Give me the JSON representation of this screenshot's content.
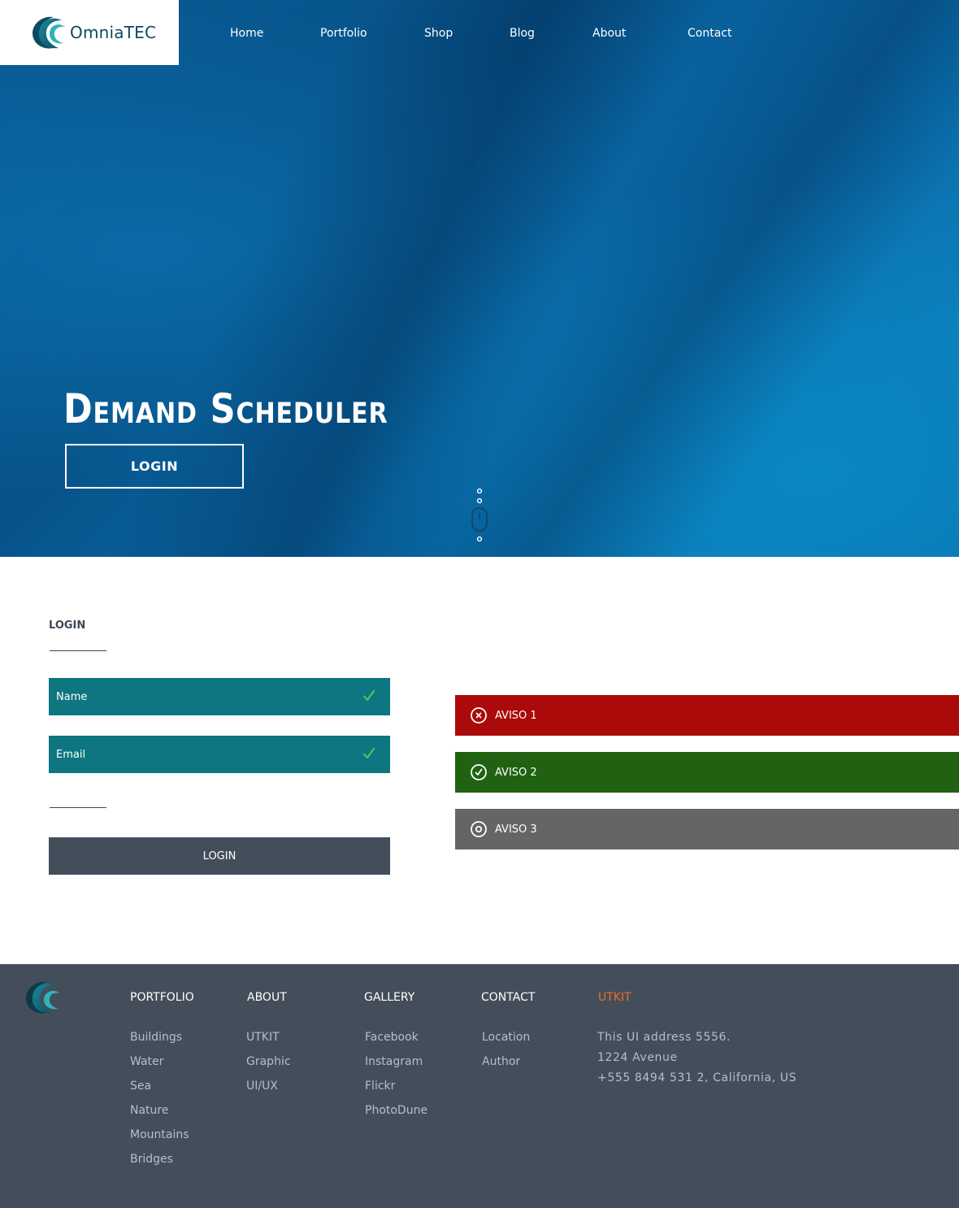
{
  "header": {
    "logo_text": "OmniaTEC",
    "nav": [
      "Home",
      "Portfolio",
      "Shop",
      "Blog",
      "About",
      "Contact"
    ],
    "search_icon": "search-icon"
  },
  "hero": {
    "title": "Demand Scheduler",
    "button": "LOGIN"
  },
  "login": {
    "title": "LOGIN",
    "fields": [
      {
        "label": "Name",
        "status_icon": "check-icon"
      },
      {
        "label": "Email",
        "status_icon": "check-icon"
      }
    ],
    "button": "LOGIN"
  },
  "alerts": [
    {
      "label": "AVISO 1",
      "icon": "x-circle-icon",
      "color": "#aa0a09"
    },
    {
      "label": "AVISO 2",
      "icon": "check-circle-icon",
      "color": "#206212"
    },
    {
      "label": "AVISO 3",
      "icon": "target-circle-icon",
      "color": "#656565"
    }
  ],
  "footer": {
    "columns": [
      {
        "title": "PORTFOLIO",
        "links": [
          "Buildings",
          "Water",
          "Sea",
          "Nature",
          "Mountains",
          "Bridges"
        ]
      },
      {
        "title": "ABOUT",
        "links": [
          "UTKIT",
          "Graphic",
          "UI/UX"
        ]
      },
      {
        "title": "GALLERY",
        "links": [
          "Facebook",
          "Instagram",
          "Flickr",
          "PhotoDune"
        ]
      },
      {
        "title": "CONTACT",
        "links": [
          "Location",
          "Author"
        ]
      }
    ],
    "brand": {
      "title": "UTKIT",
      "color": "#f26a21",
      "address": [
        "This UI address 5556.",
        "1224 Avenue",
        "+555 8494 531 2, California, US"
      ]
    }
  },
  "colors": {
    "teal_field": "#0d7680",
    "dark_slate": "#434e5a",
    "check_green": "#3fd35a"
  }
}
